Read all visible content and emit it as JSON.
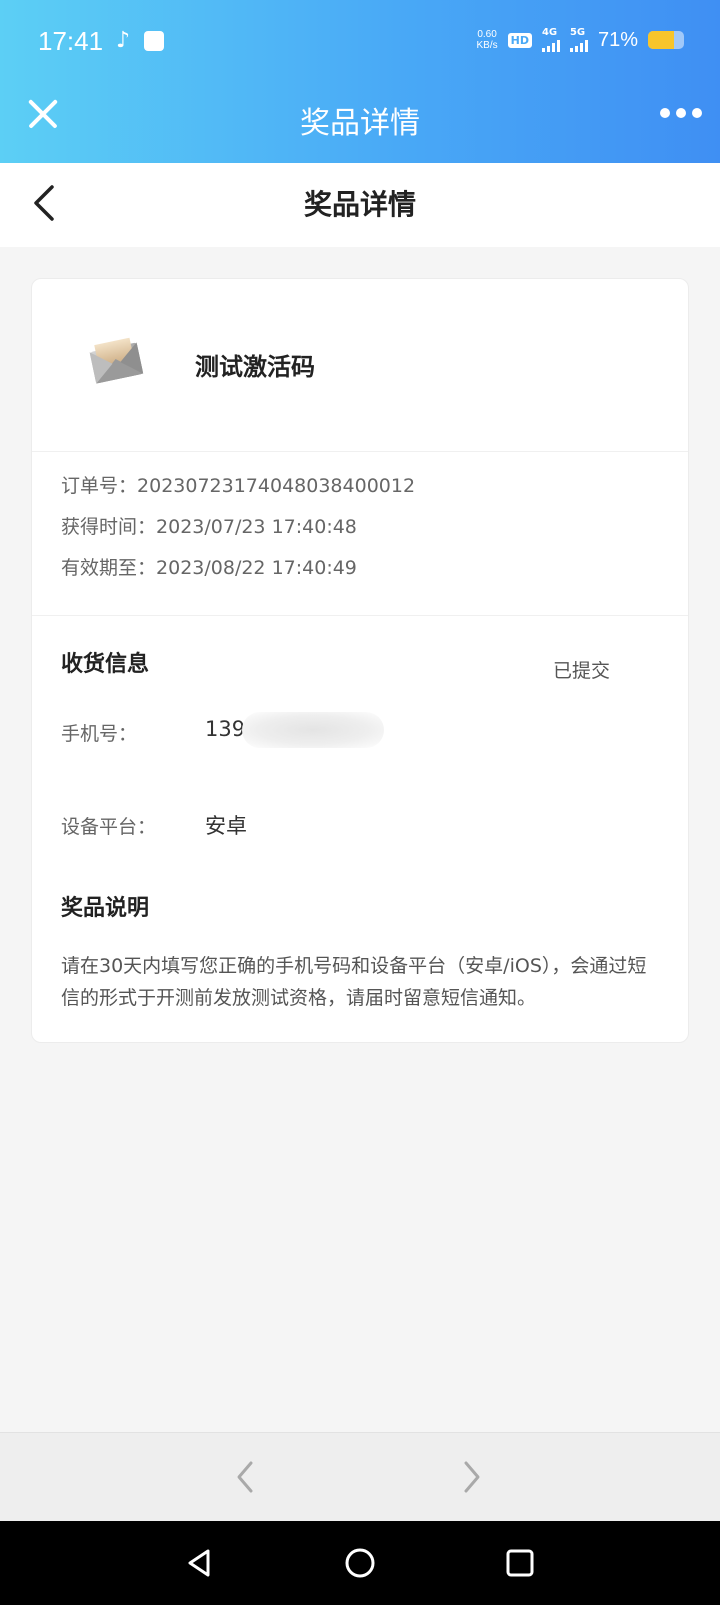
{
  "status_bar": {
    "time": "17:41",
    "net_speed_value": "0.60",
    "net_speed_unit": "KB/s",
    "hd_label": "HD",
    "sim1_label": "4G",
    "sim2_label": "5G",
    "battery_percent": "71%",
    "battery_level": 0.71,
    "battery_color": "#f7c52b"
  },
  "app_bar": {
    "title": "奖品详情",
    "close_icon": "close-icon",
    "more_icon": "more-dots-icon"
  },
  "page_header": {
    "title": "奖品详情",
    "back_icon": "chevron-left-icon"
  },
  "prize": {
    "name": "测试激活码",
    "icon": "envelope-icon"
  },
  "order": {
    "order_no_label": "订单号：",
    "order_no": "20230723174048038400012",
    "obtained_label": "获得时间：",
    "obtained_time": "2023/07/23 17:40:48",
    "expiry_label": "有效期至：",
    "expiry_time": "2023/08/22 17:40:49"
  },
  "delivery": {
    "title": "收货信息",
    "status": "已提交",
    "phone_label": "手机号：",
    "phone_value": "139",
    "platform_label": "设备平台：",
    "platform_value": "安卓"
  },
  "description": {
    "title": "奖品说明",
    "text": "请在30天内填写您正确的手机号码和设备平台（安卓/iOS），会通过短信的形式于开测前发放测试资格，请届时留意短信通知。"
  },
  "browser_nav": {
    "prev_icon": "chevron-left-icon",
    "next_icon": "chevron-right-icon"
  },
  "colors": {
    "header_gradient_start": "#5ccff5",
    "header_gradient_end": "#3f8ff3",
    "page_background": "#f5f5f5"
  }
}
